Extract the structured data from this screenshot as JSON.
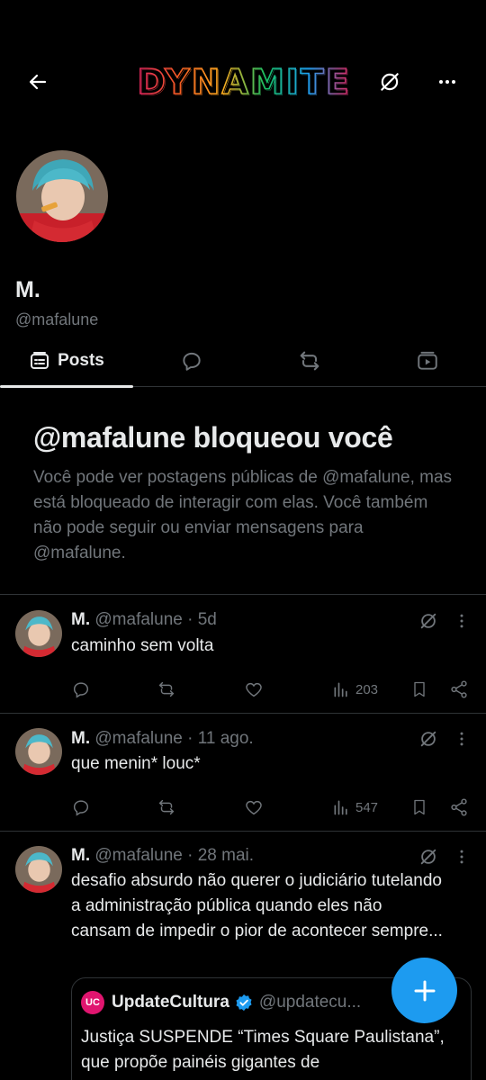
{
  "header": {
    "title": "DYNAMITE",
    "back_icon": "arrow-left-icon",
    "nosync_icon": "no-sync-icon",
    "more_icon": "more-dots-icon"
  },
  "profile": {
    "name": "M.",
    "handle": "@mafalune"
  },
  "tabs": [
    {
      "label": "Posts",
      "icon": "posts-icon",
      "active": true
    },
    {
      "label": "",
      "icon": "replies-icon",
      "active": false
    },
    {
      "label": "",
      "icon": "retweet-icon",
      "active": false
    },
    {
      "label": "",
      "icon": "media-icon",
      "active": false
    }
  ],
  "blocked": {
    "title": "@mafalune bloqueou você",
    "message": "Você pode ver postagens públicas de @mafalune, mas está bloqueado de interagir com elas. Você também não pode seguir ou enviar mensagens para @mafalune."
  },
  "tweets": [
    {
      "name": "M.",
      "meta": "@mafalune · 5d",
      "text": "caminho sem volta",
      "views": "203"
    },
    {
      "name": "M.",
      "meta": "@mafalune · 11 ago.",
      "text": "que menin* louc*",
      "views": "547"
    },
    {
      "name": "M.",
      "meta": "@mafalune · 28 mai.",
      "text": "desafio absurdo não querer o judiciário tutelando a administração pública quando eles não cansam de impedir o pior de acontecer sempre...",
      "views": ""
    }
  ],
  "quote": {
    "logo_text": "UC",
    "name": "UpdateCultura",
    "handle": "@updatecu...",
    "text": "Justiça SUSPENDE “Times Square Paulistana”, que propõe painéis gigantes de"
  },
  "colors": {
    "accent": "#1d9bf0",
    "text": "#e7e9ea",
    "muted": "#71767b",
    "border": "#2f3336"
  }
}
